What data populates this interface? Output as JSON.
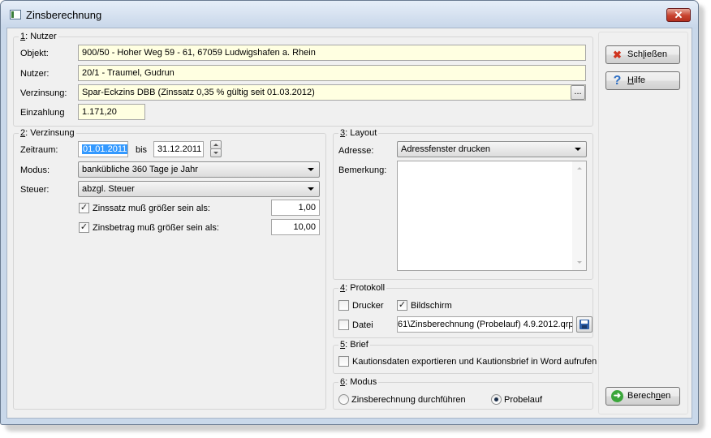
{
  "window": {
    "title": "Zinsberechnung",
    "close_label": "✕"
  },
  "nutzer": {
    "legend_num": "1",
    "legend_rest": ": Nutzer",
    "objekt_label": "Objekt:",
    "objekt_value": "900/50 - Hoher Weg 59 - 61, 67059 Ludwigshafen a. Rhein",
    "nutzer_label": "Nutzer:",
    "nutzer_value": "20/1 - Traumel, Gudrun",
    "verzinsung_label": "Verzinsung:",
    "verzinsung_value": "Spar-Eckzins DBB  (Zinssatz 0,35 % gültig seit 01.03.2012)",
    "browse_label": "...",
    "einzahlung_label": "Einzahlung",
    "einzahlung_value": "1.171,20"
  },
  "verzinsung": {
    "legend_num": "2",
    "legend_rest": ": Verzinsung",
    "zeitraum_label": "Zeitraum:",
    "from": "01.01.2011",
    "bis_label": "bis",
    "to": "31.12.2011",
    "modus_label": "Modus:",
    "modus_value": "bankübliche 360 Tage je Jahr",
    "steuer_label": "Steuer:",
    "steuer_value": "abzgl. Steuer",
    "zinssatz_check_label": "Zinssatz muß größer sein als:",
    "zinssatz_value": "1,00",
    "zinsbetrag_check_label": "Zinsbetrag muß größer sein als:",
    "zinsbetrag_value": "10,00",
    "check_mark": "✓"
  },
  "layout": {
    "legend_num": "3",
    "legend_rest": ": Layout",
    "adresse_label": "Adresse:",
    "adresse_value": "Adressfenster drucken",
    "bemerkung_label": "Bemerkung:"
  },
  "protokoll": {
    "legend_num": "4",
    "legend_rest": ": Protokoll",
    "drucker_label": "Drucker",
    "bildschirm_label": "Bildschirm",
    "datei_label": "Datei",
    "datei_path": "61\\Zinsberechnung  (Probelauf) 4.9.2012.qrp"
  },
  "brief": {
    "legend_num": "5",
    "legend_rest": ": Brief",
    "export_label": "Kautionsdaten exportieren und Kautionsbrief in Word aufrufen"
  },
  "modus": {
    "legend_num": "6",
    "legend_rest": ": Modus",
    "durchfuehren_label": "Zinsberechnung durchführen",
    "probelauf_label": "Probelauf"
  },
  "buttons": {
    "schliessen_pre": "Sch",
    "schliessen_u": "l",
    "schliessen_post": "ießen",
    "hilfe_u": "H",
    "hilfe_post": "ilfe",
    "berechnen_pre": "Berech",
    "berechnen_u": "n",
    "berechnen_post": "en"
  },
  "colors": {
    "field_yellow": "#ffffe1",
    "selection": "#3399ff",
    "close_red": "#c8432f"
  }
}
